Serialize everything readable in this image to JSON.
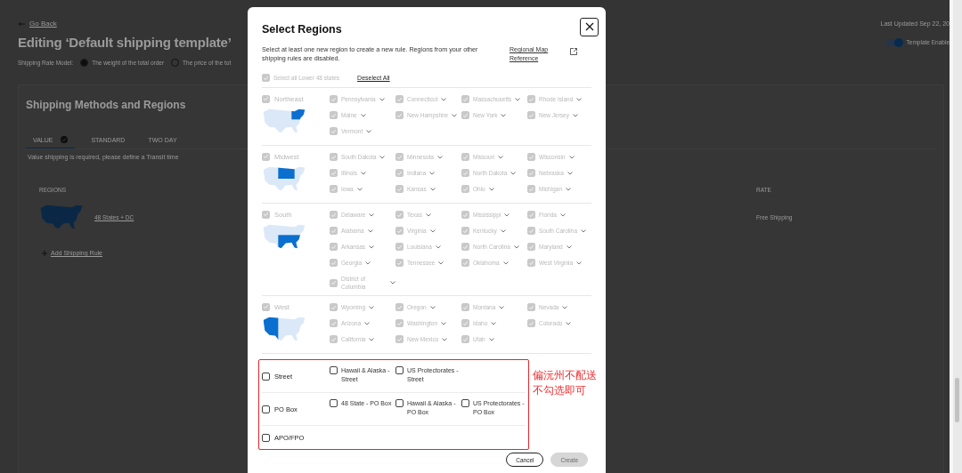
{
  "page": {
    "back_link": "Go Back",
    "last_updated": "Last Updated Sep 22, 20",
    "title": "Editing ‘Default shipping template’",
    "template_toggle": {
      "label": "Template Enable",
      "on": true
    },
    "rate_model": {
      "label": "Shipping Rate Model:",
      "options": [
        {
          "label": "The weight of the total order",
          "selected": true
        },
        {
          "label": "The price of the tot",
          "selected": false
        }
      ]
    },
    "card": {
      "title": "Shipping Methods and Regions",
      "tabs": [
        {
          "label": "VALUE",
          "selected": true,
          "complete": true
        },
        {
          "label": "STANDARD",
          "selected": false,
          "complete": false
        },
        {
          "label": "TWO DAY",
          "selected": false,
          "complete": false
        }
      ],
      "note": "Value shipping is required, please define a Transit time",
      "columns": [
        "REGIONS",
        "RATE"
      ],
      "rules": [
        {
          "region": "48 States + DC",
          "rate": "Free Shipping"
        }
      ],
      "add_rule": "Add Shipping Rule"
    }
  },
  "modal": {
    "title": "Select Regions",
    "description": "Select at least one new region to create a new rule. Regions from your other shipping rules are disabled.",
    "map_link": "Regional Map Reference",
    "select_all": {
      "label": "Select all Lower 48 states",
      "checked": true,
      "disabled": true
    },
    "deselect_all": "Deselect All",
    "regions": [
      {
        "name": "Northeast",
        "checked": true,
        "disabled": true,
        "states": [
          {
            "name": "Pennsylvania",
            "checked": true
          },
          {
            "name": "Connecticut",
            "checked": true
          },
          {
            "name": "Massachusetts",
            "checked": true
          },
          {
            "name": "Rhode Island",
            "checked": true
          },
          {
            "name": "Maine",
            "checked": true
          },
          {
            "name": "New Hampshire",
            "checked": true
          },
          {
            "name": "New York",
            "checked": true
          },
          {
            "name": "New Jersey",
            "checked": true
          },
          {
            "name": "Vermont",
            "checked": true
          }
        ]
      },
      {
        "name": "Midwest",
        "checked": true,
        "disabled": true,
        "states": [
          {
            "name": "South Dakota",
            "checked": true
          },
          {
            "name": "Minnesota",
            "checked": true
          },
          {
            "name": "Missouri",
            "checked": true
          },
          {
            "name": "Wisconsin",
            "checked": true
          },
          {
            "name": "Illinois",
            "checked": true
          },
          {
            "name": "Indiana",
            "checked": true
          },
          {
            "name": "North Dakota",
            "checked": true
          },
          {
            "name": "Nebraska",
            "checked": true
          },
          {
            "name": "Iowa",
            "checked": true
          },
          {
            "name": "Kansas",
            "checked": true
          },
          {
            "name": "Ohio",
            "checked": true
          },
          {
            "name": "Michigan",
            "checked": true
          }
        ]
      },
      {
        "name": "South",
        "checked": true,
        "disabled": true,
        "states": [
          {
            "name": "Delaware",
            "checked": true
          },
          {
            "name": "Texas",
            "checked": true
          },
          {
            "name": "Mississippi",
            "checked": true
          },
          {
            "name": "Florida",
            "checked": true
          },
          {
            "name": "Alabama",
            "checked": true
          },
          {
            "name": "Virginia",
            "checked": true
          },
          {
            "name": "Kentucky",
            "checked": true
          },
          {
            "name": "South Carolina",
            "checked": true
          },
          {
            "name": "Arkansas",
            "checked": true
          },
          {
            "name": "Louisiana",
            "checked": true
          },
          {
            "name": "North Carolina",
            "checked": true
          },
          {
            "name": "Maryland",
            "checked": true
          },
          {
            "name": "Georgia",
            "checked": true
          },
          {
            "name": "Tennessee",
            "checked": true
          },
          {
            "name": "Oklahoma",
            "checked": true
          },
          {
            "name": "West Virginia",
            "checked": true
          },
          {
            "name": "District of Columbia",
            "checked": true
          }
        ]
      },
      {
        "name": "West",
        "checked": true,
        "disabled": true,
        "states": [
          {
            "name": "Wyoming",
            "checked": true
          },
          {
            "name": "Oregon",
            "checked": true
          },
          {
            "name": "Montana",
            "checked": true
          },
          {
            "name": "Nevada",
            "checked": true
          },
          {
            "name": "Arizona",
            "checked": true
          },
          {
            "name": "Washington",
            "checked": true
          },
          {
            "name": "Idaho",
            "checked": true
          },
          {
            "name": "Colorado",
            "checked": true
          },
          {
            "name": "California",
            "checked": true
          },
          {
            "name": "New Mexico",
            "checked": true
          },
          {
            "name": "Utah",
            "checked": true
          }
        ]
      }
    ],
    "address_types": [
      {
        "name": "Street",
        "checked": false,
        "options": [
          {
            "name": "Hawaii & Alaska - Street",
            "checked": false
          },
          {
            "name": "US Protectorates - Street",
            "checked": false
          }
        ]
      },
      {
        "name": "PO Box",
        "checked": false,
        "options": [
          {
            "name": "48 State - PO Box",
            "checked": false
          },
          {
            "name": "Hawaii & Alaska - PO Box",
            "checked": false
          },
          {
            "name": "US Protectorates - PO Box",
            "checked": false
          }
        ]
      },
      {
        "name": "APO/FPO",
        "checked": false
      }
    ],
    "buttons": [
      {
        "label": "Cancel",
        "disabled": false
      },
      {
        "label": "Create",
        "disabled": true
      }
    ]
  },
  "annotation": {
    "lines": [
      "偏沅州不配送",
      "不勾选即可"
    ]
  }
}
